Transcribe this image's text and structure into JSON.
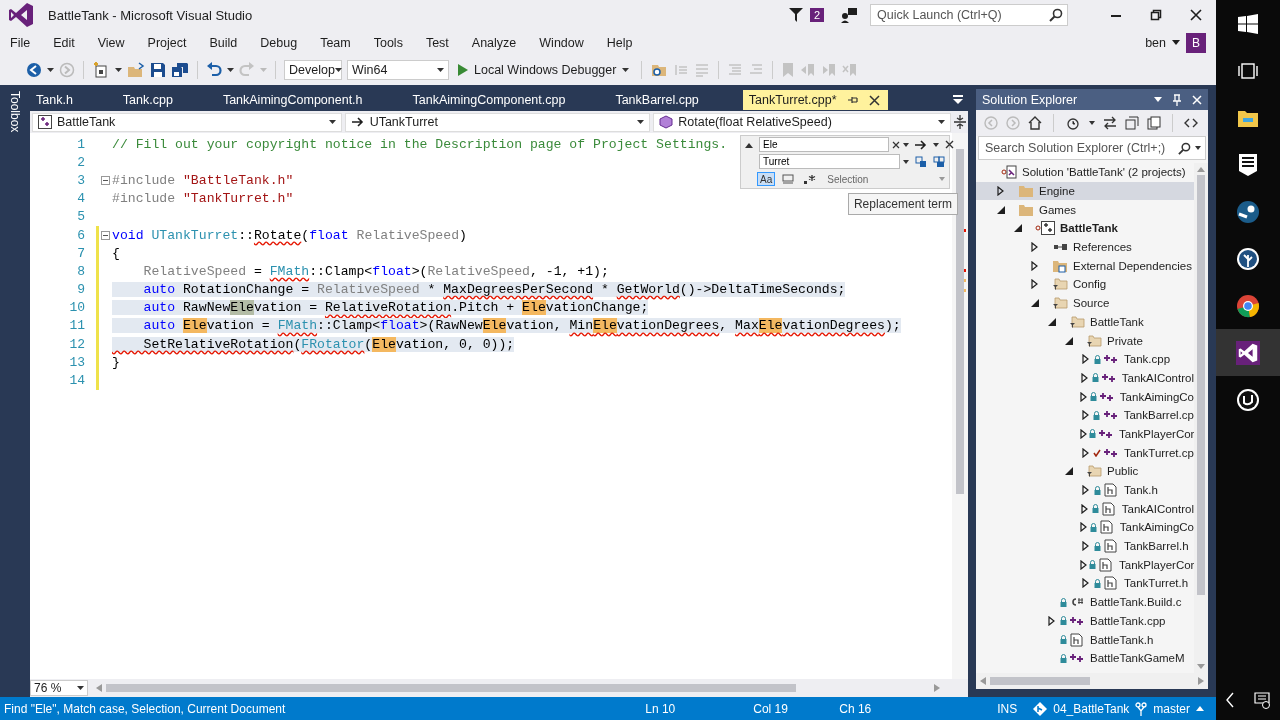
{
  "window": {
    "title": "BattleTank - Microsoft Visual Studio",
    "notifications": "2",
    "quick_launch": {
      "placeholder": "Quick Launch (Ctrl+Q)"
    },
    "user": "ben",
    "avatar": "B"
  },
  "menu": [
    "File",
    "Edit",
    "View",
    "Project",
    "Build",
    "Debug",
    "Team",
    "Tools",
    "Test",
    "Analyze",
    "Window",
    "Help"
  ],
  "toolbar": {
    "configuration": "Develop",
    "platform": "Win64",
    "debugger": "Local Windows Debugger"
  },
  "toolbox_tab": "Toolbox",
  "tabs": [
    {
      "label": "Tank.h",
      "selected": false
    },
    {
      "label": "Tank.cpp",
      "selected": false
    },
    {
      "label": "TankAimingComponent.h",
      "selected": false
    },
    {
      "label": "TankAimingComponent.cpp",
      "selected": false
    },
    {
      "label": "TankBarrel.cpp",
      "selected": false
    },
    {
      "label": "TankTurret.cpp*",
      "selected": true
    }
  ],
  "navigation": [
    {
      "kind": "project",
      "label": "BattleTank"
    },
    {
      "kind": "class",
      "label": "UTankTurret"
    },
    {
      "kind": "method",
      "label": "Rotate(float RelativeSpeed)"
    }
  ],
  "find": {
    "find_value": "Ele",
    "replace_value": "Turret",
    "scope": "Selection",
    "tooltip": "Replacement term",
    "options": [
      {
        "kind": "case",
        "label": "Aa",
        "selected": true
      },
      {
        "kind": "word",
        "selected": false
      },
      {
        "kind": "regex",
        "selected": false
      }
    ]
  },
  "editor": {
    "zoom": "76 %",
    "lines": [
      {
        "num": "1",
        "fold": false,
        "changed": false,
        "selected": false,
        "segments": [
          {
            "t": "// Fill out your copyright notice in the Description page of Project Settings.",
            "kind": "comment"
          }
        ]
      },
      {
        "num": "2",
        "fold": false,
        "changed": false,
        "selected": false
      },
      {
        "num": "3",
        "fold": true,
        "changed": false,
        "selected": false,
        "segments": [
          {
            "t": "#include ",
            "kind": "pp"
          },
          {
            "t": "\"BattleTank.h\"",
            "kind": "str"
          }
        ]
      },
      {
        "num": "4",
        "fold": false,
        "changed": false,
        "selected": false,
        "segments": [
          {
            "t": "#include ",
            "kind": "pp"
          },
          {
            "t": "\"TankTurret.h\"",
            "kind": "str"
          }
        ]
      },
      {
        "num": "5",
        "fold": false,
        "changed": false,
        "selected": false
      },
      {
        "num": "6",
        "fold": true,
        "changed": true,
        "selected": false,
        "segments": [
          {
            "t": "void",
            "kind": "kw"
          },
          {
            "t": " UTankTurret",
            "kind": "type"
          },
          {
            "t": "::"
          },
          {
            "t": "Rotate",
            "squiggle": true
          },
          {
            "t": "("
          },
          {
            "t": "float",
            "kind": "kw"
          },
          {
            "t": " RelativeSpeed",
            "kind": "gray"
          },
          {
            "t": ")"
          }
        ]
      },
      {
        "num": "7",
        "fold": false,
        "changed": true,
        "selected": false,
        "segments": [
          {
            "t": "{"
          }
        ]
      },
      {
        "num": "8",
        "fold": false,
        "changed": true,
        "selected": false,
        "segments": [
          {
            "t": "    RelativeSpeed",
            "kind": "gray"
          },
          {
            "t": " = "
          },
          {
            "t": "FMath",
            "kind": "type",
            "squiggle": true
          },
          {
            "t": "::Clamp<"
          },
          {
            "t": "float",
            "kind": "kw"
          },
          {
            "t": ">("
          },
          {
            "t": "RelativeSpeed",
            "kind": "gray"
          },
          {
            "t": ", -1, +1);"
          }
        ]
      },
      {
        "num": "9",
        "fold": false,
        "changed": true,
        "selected": true,
        "segments": [
          {
            "t": "    auto",
            "kind": "kw"
          },
          {
            "t": " RotationChange = "
          },
          {
            "t": "RelativeSpeed",
            "kind": "gray"
          },
          {
            "t": " * "
          },
          {
            "t": "MaxDegreesPerSecond",
            "squiggle": true
          },
          {
            "t": " * "
          },
          {
            "t": "GetWorld",
            "squiggle": true
          },
          {
            "t": "()->DeltaTimeSeconds;"
          }
        ]
      },
      {
        "num": "10",
        "fold": false,
        "changed": true,
        "selected": true,
        "segments": [
          {
            "t": "    auto",
            "kind": "kw"
          },
          {
            "t": " RawNew"
          },
          {
            "t": "Ele",
            "kind": "current"
          },
          {
            "t": "vation = "
          },
          {
            "t": "RelativeRotation",
            "squiggle": true
          },
          {
            "t": ".Pitch + "
          },
          {
            "t": "Ele",
            "kind": "match"
          },
          {
            "t": "vationChange;"
          }
        ]
      },
      {
        "num": "11",
        "fold": false,
        "changed": true,
        "selected": true,
        "segments": [
          {
            "t": "    auto ",
            "kind": "kw"
          },
          {
            "t": "Ele",
            "kind": "match"
          },
          {
            "t": "vation = "
          },
          {
            "t": "FMath",
            "kind": "type",
            "squiggle": true
          },
          {
            "t": "::Clamp<"
          },
          {
            "t": "float",
            "kind": "kw"
          },
          {
            "t": ">(RawNew"
          },
          {
            "t": "Ele",
            "kind": "match"
          },
          {
            "t": "vation, "
          },
          {
            "t": "Min",
            "squiggle": true
          },
          {
            "t": "Ele",
            "kind": "match",
            "squiggle": true
          },
          {
            "t": "vationDegrees",
            "squiggle": true
          },
          {
            "t": ", "
          },
          {
            "t": "Max",
            "squiggle": true
          },
          {
            "t": "Ele",
            "kind": "match",
            "squiggle": true
          },
          {
            "t": "vationDegrees",
            "squiggle": true
          },
          {
            "t": ");"
          }
        ]
      },
      {
        "num": "12",
        "fold": false,
        "changed": true,
        "selected": true,
        "segments": [
          {
            "t": "    SetRelativeRotation",
            "squiggle": true
          },
          {
            "t": "("
          },
          {
            "t": "FRotator",
            "kind": "type",
            "squiggle": true
          },
          {
            "t": "("
          },
          {
            "t": "Ele",
            "kind": "match"
          },
          {
            "t": "vation, 0, 0));"
          }
        ]
      },
      {
        "num": "13",
        "fold": false,
        "changed": true,
        "selected": false,
        "segments": [
          {
            "t": "}"
          }
        ]
      },
      {
        "num": "14",
        "fold": false,
        "changed": true,
        "selected": false
      }
    ]
  },
  "solution_explorer": {
    "title": "Solution Explorer",
    "search": {
      "placeholder": "Search Solution Explorer (Ctrl+;)"
    },
    "tree": [
      {
        "kind": "solution",
        "label": "Solution 'BattleTank' (2 projects)",
        "selected": false,
        "children": [
          {
            "kind": "folder",
            "label": "Engine",
            "expanded": false,
            "selected": true
          },
          {
            "kind": "folder",
            "label": "Games",
            "expanded": true,
            "selected": false,
            "children": [
              {
                "kind": "project",
                "label": "BattleTank",
                "expanded": true,
                "selected": false,
                "children": [
                  {
                    "kind": "references",
                    "label": "References",
                    "expanded": false,
                    "selected": false
                  },
                  {
                    "kind": "external",
                    "label": "External Dependencies",
                    "expanded": false,
                    "selected": false
                  },
                  {
                    "kind": "filter",
                    "label": "Config",
                    "expanded": false,
                    "selected": false
                  },
                  {
                    "kind": "filter",
                    "label": "Source",
                    "expanded": true,
                    "selected": false,
                    "children": [
                      {
                        "kind": "filter",
                        "label": "BattleTank",
                        "expanded": true,
                        "selected": false,
                        "children": [
                          {
                            "kind": "filter",
                            "label": "Private",
                            "expanded": true,
                            "selected": false,
                            "children": [
                              {
                                "kind": "cpp",
                                "label": "Tank.cpp",
                                "expanded": false,
                                "selected": false,
                                "checked_out": false
                              },
                              {
                                "kind": "cpp",
                                "label": "TankAIControl",
                                "expanded": false,
                                "selected": false,
                                "checked_out": false
                              },
                              {
                                "kind": "cpp",
                                "label": "TankAimingCo",
                                "expanded": false,
                                "selected": false,
                                "checked_out": false
                              },
                              {
                                "kind": "cpp",
                                "label": "TankBarrel.cp",
                                "expanded": false,
                                "selected": false,
                                "checked_out": false
                              },
                              {
                                "kind": "cpp",
                                "label": "TankPlayerCor",
                                "expanded": false,
                                "selected": false,
                                "checked_out": false
                              },
                              {
                                "kind": "cpp",
                                "label": "TankTurret.cp",
                                "expanded": false,
                                "selected": false,
                                "checked_out": true
                              }
                            ]
                          },
                          {
                            "kind": "filter",
                            "label": "Public",
                            "expanded": true,
                            "selected": false,
                            "children": [
                              {
                                "kind": "header",
                                "label": "Tank.h",
                                "expanded": false,
                                "selected": false,
                                "checked_out": false
                              },
                              {
                                "kind": "header",
                                "label": "TankAIControl",
                                "expanded": false,
                                "selected": false,
                                "checked_out": false
                              },
                              {
                                "kind": "header",
                                "label": "TankAimingCo",
                                "expanded": false,
                                "selected": false,
                                "checked_out": false
                              },
                              {
                                "kind": "header",
                                "label": "TankBarrel.h",
                                "expanded": false,
                                "selected": false,
                                "checked_out": false
                              },
                              {
                                "kind": "header",
                                "label": "TankPlayerCor",
                                "expanded": false,
                                "selected": false,
                                "checked_out": false
                              },
                              {
                                "kind": "header",
                                "label": "TankTurret.h",
                                "expanded": false,
                                "selected": false,
                                "checked_out": false
                              }
                            ]
                          }
                        ]
                      },
                      {
                        "kind": "csharp",
                        "label": "BattleTank.Build.c",
                        "selected": false,
                        "checked_out": false
                      },
                      {
                        "kind": "cpp",
                        "label": "BattleTank.cpp",
                        "expanded": false,
                        "selected": false,
                        "checked_out": false
                      },
                      {
                        "kind": "header",
                        "label": "BattleTank.h",
                        "selected": false,
                        "checked_out": false
                      },
                      {
                        "kind": "cpp",
                        "label": "BattleTankGameM",
                        "selected": false,
                        "checked_out": false
                      }
                    ]
                  }
                ]
              }
            ]
          }
        ]
      }
    ]
  },
  "status_bar": {
    "message": "Find \"Ele\", Match case, Selection, Current Document",
    "line": "Ln 10",
    "column": "Col 19",
    "char": "Ch 16",
    "mode": "INS",
    "repository": "04_BattleTank",
    "branch": "master"
  },
  "taskbar": [
    {
      "kind": "windows",
      "selected": false
    },
    {
      "kind": "taskview",
      "selected": false
    },
    {
      "kind": "explorer",
      "selected": false
    },
    {
      "kind": "epic",
      "selected": false
    },
    {
      "kind": "steam",
      "selected": false
    },
    {
      "kind": "tree",
      "selected": false
    },
    {
      "kind": "chrome",
      "selected": false
    },
    {
      "kind": "vs",
      "selected": true
    },
    {
      "kind": "unreal",
      "selected": false
    }
  ]
}
